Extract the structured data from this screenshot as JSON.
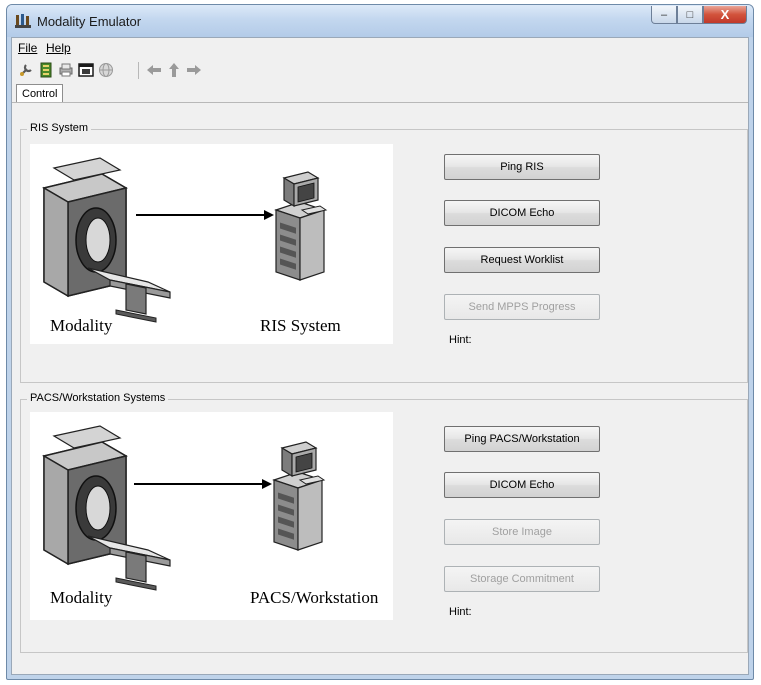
{
  "window": {
    "title": "Modality Emulator",
    "caption_buttons": {
      "minimize": "–",
      "maximize": "□",
      "close": "X"
    }
  },
  "menu": {
    "file": "File",
    "help": "Help"
  },
  "toolbar": {
    "icons": [
      "wrench-icon",
      "book-icon",
      "printer-icon",
      "window-icon",
      "globe-icon",
      "back-arrow-icon",
      "up-arrow-icon",
      "forward-arrow-icon"
    ]
  },
  "tab": {
    "label": "Control"
  },
  "ris": {
    "group_title": "RIS System",
    "left_label": "Modality",
    "right_label": "RIS System",
    "buttons": {
      "ping": "Ping RIS",
      "echo": "DICOM Echo",
      "worklist": "Request Worklist",
      "mpps": "Send MPPS Progress"
    },
    "hint": "Hint:"
  },
  "pacs": {
    "group_title": "PACS/Workstation Systems",
    "left_label": "Modality",
    "right_label": "PACS/Workstation",
    "buttons": {
      "ping": "Ping PACS/Workstation",
      "echo": "DICOM Echo",
      "store": "Store Image",
      "commit": "Storage Commitment"
    },
    "hint": "Hint:"
  },
  "colors": {
    "title_bar": "#c3d7ef",
    "close_button": "#d2533c",
    "client_bg": "#f0f0f0",
    "disabled_text": "#a0a0a0"
  }
}
